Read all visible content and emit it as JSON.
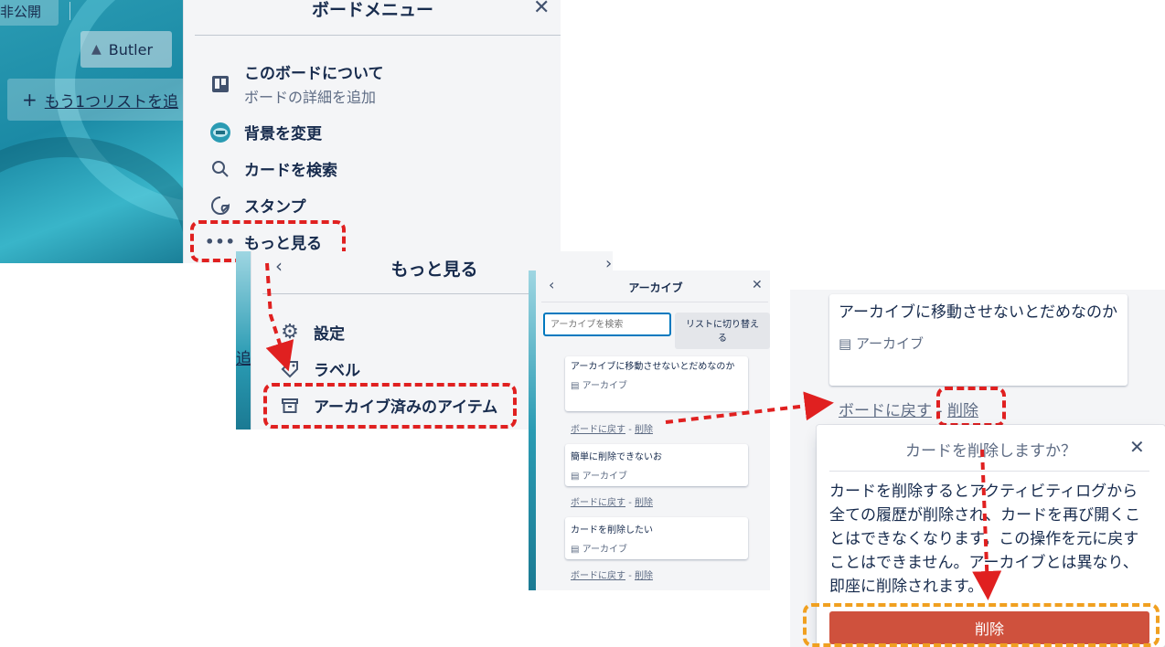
{
  "board": {
    "visibility_label": "非公開",
    "butler_label": "Butler",
    "add_list_label": "もう1つリストを追"
  },
  "board_menu": {
    "title": "ボードメニュー",
    "items": [
      {
        "label": "このボードについて",
        "sub": "ボードの詳細を追加",
        "icon": "board-icon"
      },
      {
        "label": "背景を変更",
        "icon": "background-thumbnail"
      },
      {
        "label": "カードを検索",
        "icon": "search-icon"
      },
      {
        "label": "スタンプ",
        "icon": "sticker-icon"
      },
      {
        "label": "もっと見る",
        "icon": "ellipsis-icon"
      }
    ]
  },
  "more_menu": {
    "title": "もっと見る",
    "side_text": "追",
    "items": [
      {
        "label": "設定",
        "icon": "gear-icon"
      },
      {
        "label": "ラベル",
        "icon": "label-icon"
      },
      {
        "label": "アーカイブ済みのアイテム",
        "icon": "archive-icon"
      }
    ]
  },
  "archive_panel": {
    "title": "アーカイブ",
    "search_placeholder": "アーカイブを検索",
    "switch_label": "リストに切り替える",
    "cards": [
      {
        "title": "アーカイブに移動させないとだめなのか",
        "badge": "アーカイブ"
      },
      {
        "title": "簡単に削除できないお",
        "badge": "アーカイブ"
      },
      {
        "title": "カードを削除したい",
        "badge": "アーカイブ"
      }
    ],
    "back_label": "ボードに戻す",
    "separator": "-",
    "delete_label": "削除"
  },
  "zoom_card": {
    "title": "アーカイブに移動させないとだめなのか",
    "badge": "アーカイブ",
    "back_label": "ボードに戻す",
    "separator": "-",
    "delete_label": "削除"
  },
  "confirm_dialog": {
    "title": "カードを削除しますか？",
    "body": "カードを削除するとアクティビティログから全ての履歴が削除され、カードを再び開くことはできなくなります。この操作を元に戻すことはできません。アーカイブとは異なり、即座に削除されます。",
    "delete_button": "削除"
  },
  "colors": {
    "highlight_red": "#e02020",
    "highlight_orange": "#f0a020",
    "danger": "#cf513d"
  }
}
